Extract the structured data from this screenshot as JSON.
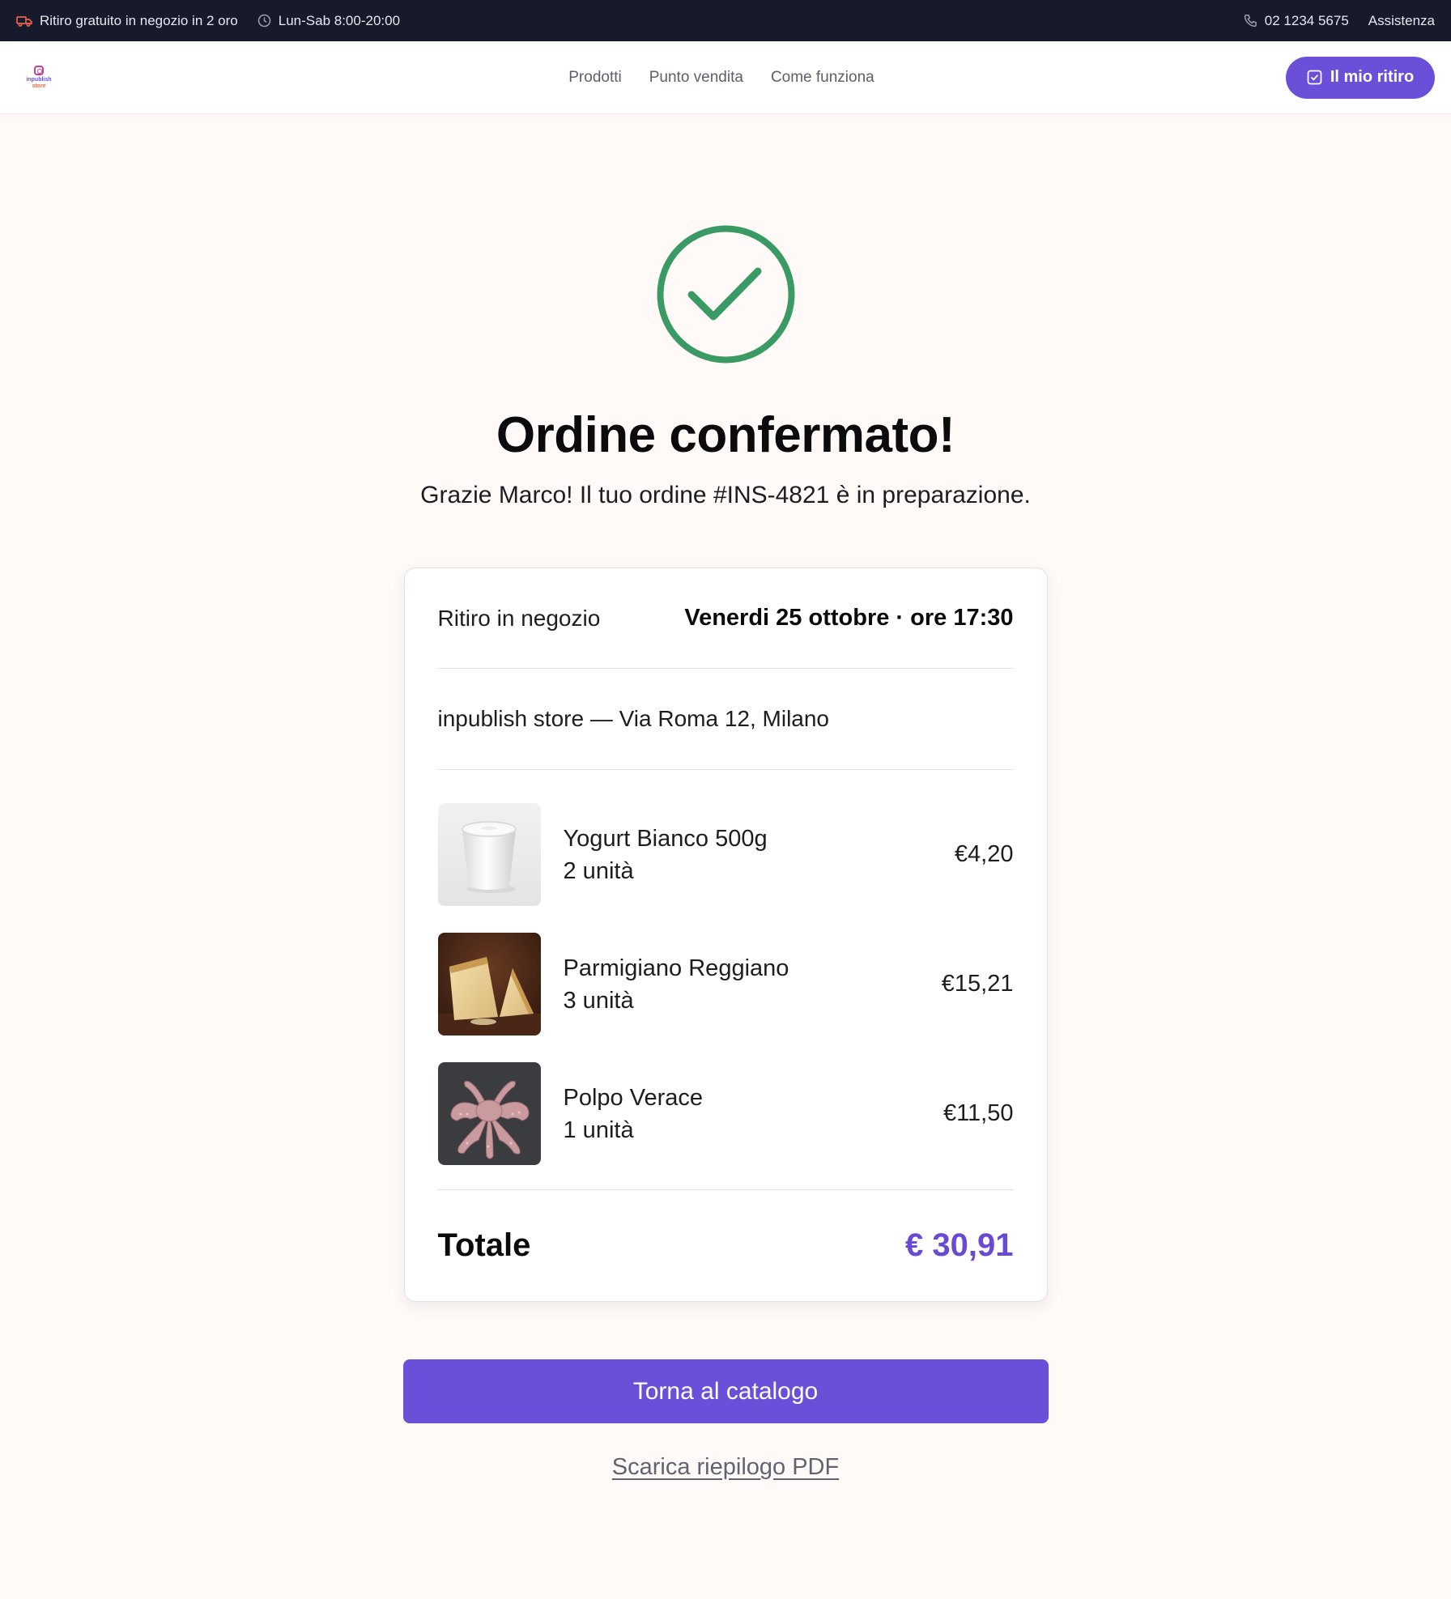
{
  "topbar": {
    "pickup_note": "Ritiro gratuito in negozio in 2 oro",
    "hours": "Lun-Sab 8:00-20:00",
    "phone": "02 1234 5675",
    "support": "Assistenza"
  },
  "header": {
    "logo_line1": "inpublish",
    "logo_line2": "store",
    "nav": [
      "Prodotti",
      "Punto vendita",
      "Come funziona"
    ],
    "cta": "Il mio ritiro"
  },
  "confirmation": {
    "title": "Ordine confermato!",
    "subtitle": "Grazie Marco! Il tuo ordine #INS-4821 è in preparazione."
  },
  "order": {
    "pickup_label": "Ritiro in negozio",
    "pickup_date": "Venerdi 25 ottobre · ore 17:30",
    "store": "inpublish store — Via Roma 12, Milano",
    "items": [
      {
        "name": "Yogurt Bianco 500g",
        "qty": "2 unità",
        "price": "€4,20"
      },
      {
        "name": "Parmigiano Reggiano",
        "qty": "3 unità",
        "price": "€15,21"
      },
      {
        "name": "Polpo Verace",
        "qty": "1 unità",
        "price": "€11,50"
      }
    ],
    "total_label": "Totale",
    "total_value": "€ 30,91"
  },
  "actions": {
    "catalog": "Torna al catalogo",
    "pdf": "Scarica riepilogo PDF"
  },
  "colors": {
    "accent": "#6a4fd8",
    "success": "#3a9a63",
    "topbar": "#161a2a"
  }
}
